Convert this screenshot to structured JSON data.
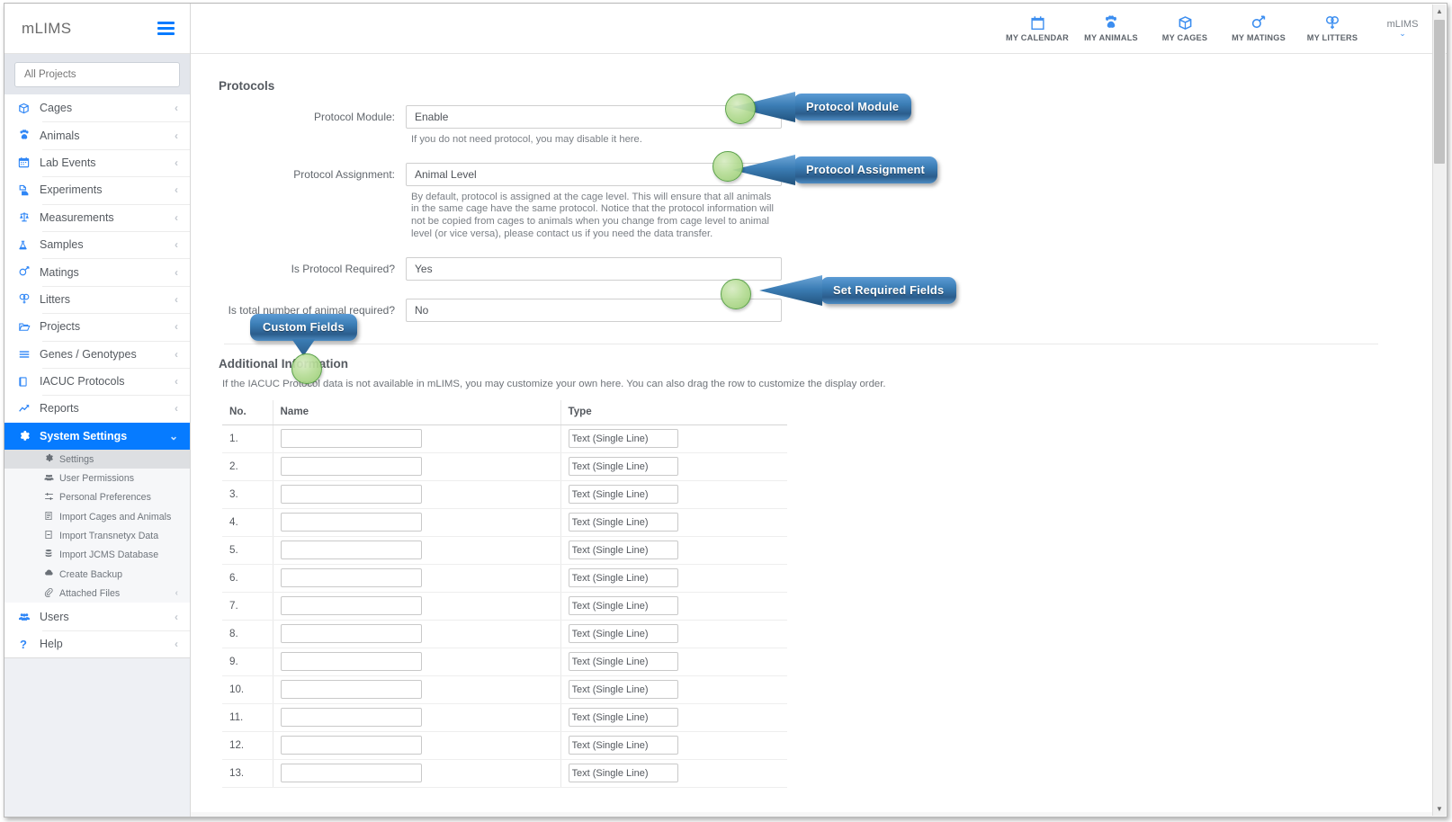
{
  "sidebar": {
    "brand": "mLIMS",
    "project_selector": {
      "value": "All Projects"
    },
    "items": [
      {
        "label": "Cages",
        "icon": "box-icon",
        "chevron": "‹"
      },
      {
        "label": "Animals",
        "icon": "paw-icon",
        "chevron": "‹"
      },
      {
        "label": "Lab Events",
        "icon": "calendar-icon",
        "chevron": "‹"
      },
      {
        "label": "Experiments",
        "icon": "flask-docs-icon",
        "chevron": "‹"
      },
      {
        "label": "Measurements",
        "icon": "balance-icon",
        "chevron": "‹"
      },
      {
        "label": "Samples",
        "icon": "flask-icon",
        "chevron": "‹"
      },
      {
        "label": "Matings",
        "icon": "male-female-icon",
        "chevron": "‹"
      },
      {
        "label": "Litters",
        "icon": "double-female-icon",
        "chevron": "‹"
      },
      {
        "label": "Projects",
        "icon": "folder-icon",
        "chevron": "‹"
      },
      {
        "label": "Genes / Genotypes",
        "icon": "list-icon",
        "chevron": "‹"
      },
      {
        "label": "IACUC Protocols",
        "icon": "book-icon",
        "chevron": "‹"
      },
      {
        "label": "Reports",
        "icon": "chart-line-icon",
        "chevron": "‹"
      }
    ],
    "active_item": {
      "label": "System Settings",
      "icon": "gear-icon",
      "chevron": "⌄"
    },
    "sub_items": [
      {
        "label": "Settings",
        "icon": "gear-icon",
        "selected": true,
        "chevron": ""
      },
      {
        "label": "User Permissions",
        "icon": "users-icon",
        "selected": false,
        "chevron": ""
      },
      {
        "label": "Personal Preferences",
        "icon": "sliders-icon",
        "selected": false,
        "chevron": ""
      },
      {
        "label": "Import Cages and Animals",
        "icon": "import-icon",
        "selected": false,
        "chevron": ""
      },
      {
        "label": "Import Transnetyx Data",
        "icon": "file-icon",
        "selected": false,
        "chevron": ""
      },
      {
        "label": "Import JCMS Database",
        "icon": "database-icon",
        "selected": false,
        "chevron": ""
      },
      {
        "label": "Create Backup",
        "icon": "cloud-icon",
        "selected": false,
        "chevron": ""
      },
      {
        "label": "Attached Files",
        "icon": "paperclip-icon",
        "selected": false,
        "chevron": "‹"
      }
    ],
    "footer_items": [
      {
        "label": "Users",
        "icon": "users-icon",
        "chevron": "‹"
      },
      {
        "label": "Help",
        "icon": "question-icon",
        "chevron": "‹"
      }
    ]
  },
  "topbar": {
    "items": [
      {
        "label": "MY CALENDAR",
        "icon": "calendar-icon"
      },
      {
        "label": "MY ANIMALS",
        "icon": "paw-icon"
      },
      {
        "label": "MY CAGES",
        "icon": "box-icon"
      },
      {
        "label": "MY MATINGS",
        "icon": "male-female-icon"
      },
      {
        "label": "MY LITTERS",
        "icon": "double-female-icon"
      }
    ],
    "account": {
      "name": "mLIMS",
      "caret": "⌄"
    }
  },
  "protocols": {
    "section_title": "Protocols",
    "fields": [
      {
        "label": "Protocol Module:",
        "value": "Enable",
        "hint": "If you do not need protocol, you may disable it here."
      },
      {
        "label": "Protocol Assignment:",
        "value": "Animal Level",
        "hint": "By default, protocol is assigned at the cage level. This will ensure that all animals in the same cage have the same protocol. Notice that the protocol information will not be copied from cages to animals when you change from cage level to animal level (or vice versa), please contact us if you need the data transfer."
      },
      {
        "label": "Is Protocol Required?",
        "value": "Yes",
        "hint": ""
      },
      {
        "label": "Is total number of animal required?",
        "value": "No",
        "hint": ""
      }
    ]
  },
  "additional_information": {
    "section_title": "Additional Information",
    "note": "If the IACUC Protocol data is not available in mLIMS, you may customize your own here. You can also drag the row to customize the display order.",
    "columns": [
      "No.",
      "Name",
      "Type"
    ],
    "rows": [
      {
        "no": "1.",
        "name": "",
        "type": "Text (Single Line)"
      },
      {
        "no": "2.",
        "name": "",
        "type": "Text (Single Line)"
      },
      {
        "no": "3.",
        "name": "",
        "type": "Text (Single Line)"
      },
      {
        "no": "4.",
        "name": "",
        "type": "Text (Single Line)"
      },
      {
        "no": "5.",
        "name": "",
        "type": "Text (Single Line)"
      },
      {
        "no": "6.",
        "name": "",
        "type": "Text (Single Line)"
      },
      {
        "no": "7.",
        "name": "",
        "type": "Text (Single Line)"
      },
      {
        "no": "8.",
        "name": "",
        "type": "Text (Single Line)"
      },
      {
        "no": "9.",
        "name": "",
        "type": "Text (Single Line)"
      },
      {
        "no": "10.",
        "name": "",
        "type": "Text (Single Line)"
      },
      {
        "no": "11.",
        "name": "",
        "type": "Text (Single Line)"
      },
      {
        "no": "12.",
        "name": "",
        "type": "Text (Single Line)"
      },
      {
        "no": "13.",
        "name": "",
        "type": "Text (Single Line)"
      }
    ]
  },
  "callouts": [
    {
      "label": "Protocol Module",
      "direction": "left"
    },
    {
      "label": "Protocol Assignment",
      "direction": "left"
    },
    {
      "label": "Set Required Fields",
      "direction": "left"
    },
    {
      "label": "Custom Fields",
      "direction": "down"
    }
  ],
  "colors": {
    "accent_blue": "#067bff",
    "icon_blue": "#3c8ef0",
    "callout_blue": "#3b7db5",
    "marker_green": "#b6dd96",
    "sidebar_bg": "#eef0f4"
  }
}
